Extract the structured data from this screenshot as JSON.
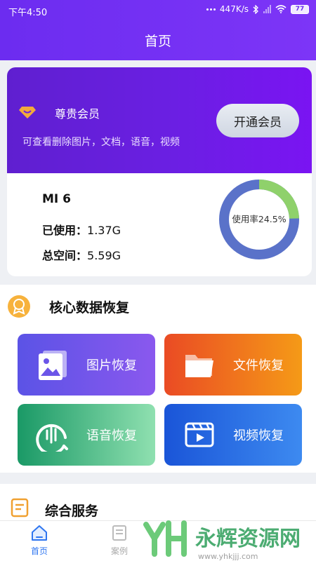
{
  "status_bar": {
    "time": "下午4:50",
    "speed": "447K/s",
    "battery": "77"
  },
  "header": {
    "title": "首页"
  },
  "vip": {
    "title": "尊贵会员",
    "description": "可查看删除图片，文档，语音，视频",
    "button": "开通会员"
  },
  "device": {
    "name": "MI 6",
    "used_label": "已使用：",
    "used_value": "1.37G",
    "total_label": "总空间：",
    "total_value": "5.59G",
    "usage_label": "使用率24.5%",
    "usage_fraction": 0.245,
    "ring_used_color": "#8fd16b",
    "ring_free_color": "#5a72c9"
  },
  "core_section": {
    "title": "核心数据恢复",
    "tiles": [
      {
        "label": "图片恢复",
        "icon": "image-icon"
      },
      {
        "label": "文件恢复",
        "icon": "folder-icon"
      },
      {
        "label": "语音恢复",
        "icon": "voice-icon"
      },
      {
        "label": "视频恢复",
        "icon": "video-icon"
      }
    ]
  },
  "service_section": {
    "title": "综合服务"
  },
  "bottom_nav": {
    "items": [
      {
        "label": "首页",
        "icon": "home-icon",
        "active": true
      },
      {
        "label": "案例",
        "icon": "case-icon",
        "active": false
      }
    ]
  },
  "watermark": {
    "text": "永辉资源网",
    "url": "www.yhkjjj.com"
  }
}
